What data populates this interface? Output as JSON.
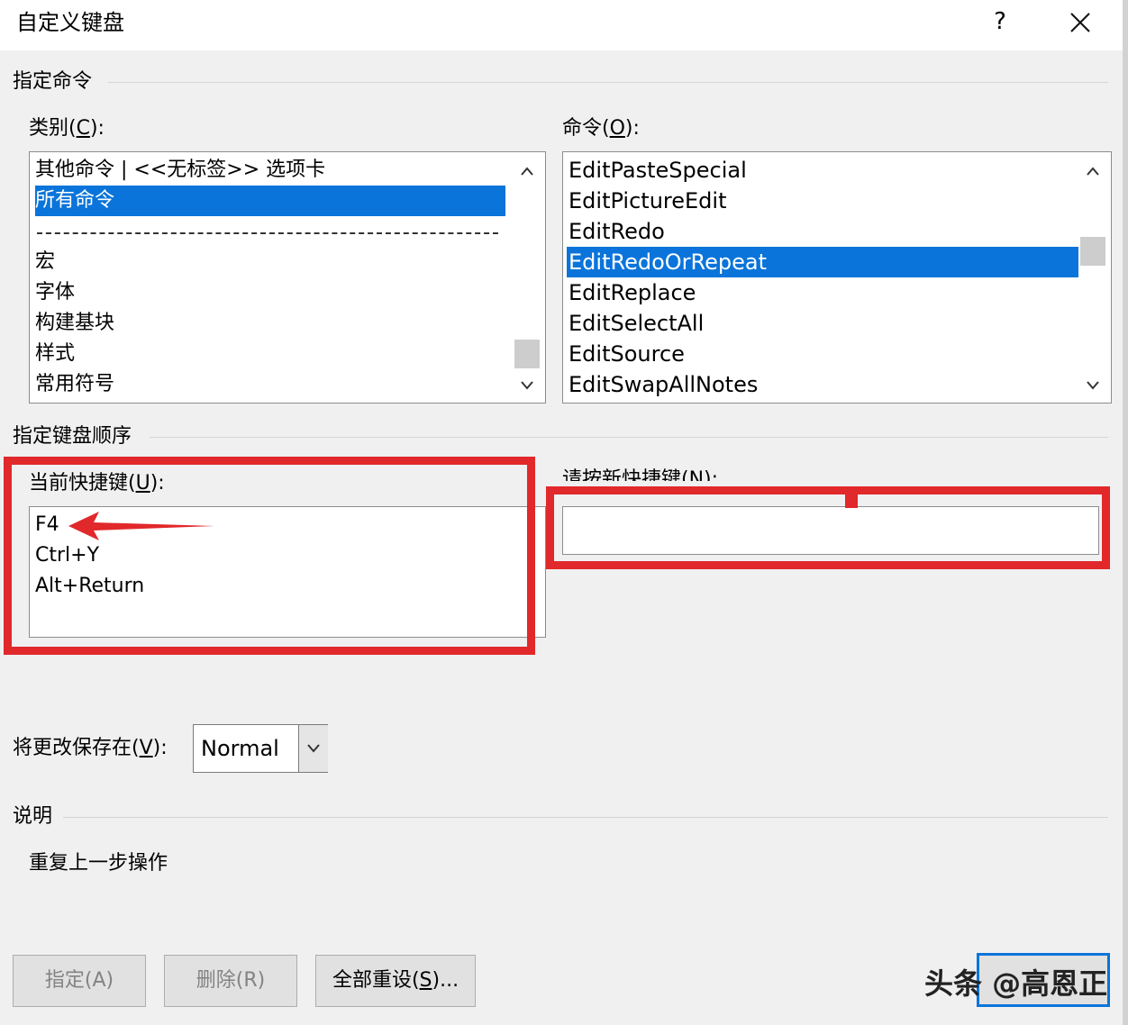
{
  "dialog": {
    "title": "自定义键盘",
    "help_label": "?",
    "close_label": "close"
  },
  "assign_command": {
    "section_title": "指定命令",
    "categories": {
      "label_prefix": "类别(",
      "label_key": "C",
      "label_suffix": "):",
      "items": [
        "其他命令 | <<无标签>> 选项卡",
        "所有命令",
        "宏",
        "字体",
        "构建基块",
        "样式",
        "常用符号"
      ],
      "selected": "所有命令"
    },
    "commands": {
      "label_prefix": "命令(",
      "label_key": "O",
      "label_suffix": "):",
      "items": [
        "EditPasteSpecial",
        "EditPictureEdit",
        "EditRedo",
        "EditRedoOrRepeat",
        "EditReplace",
        "EditSelectAll",
        "EditSource",
        "EditSwapAllNotes"
      ],
      "selected": "EditRedoOrRepeat"
    }
  },
  "keyboard_sequence": {
    "section_title": "指定键盘顺序",
    "current_keys": {
      "label_prefix": "当前快捷键(",
      "label_key": "U",
      "label_suffix": "):",
      "items": [
        "F4",
        "Ctrl+Y",
        "Alt+Return"
      ]
    },
    "new_key": {
      "label": "请按新快捷键(N):",
      "value": ""
    }
  },
  "save_in": {
    "label_prefix": "将更改保存在(",
    "label_key": "V",
    "label_suffix": "):",
    "value": "Normal"
  },
  "description": {
    "section_title": "说明",
    "text": "重复上一步操作"
  },
  "buttons": {
    "assign": "指定(A)",
    "remove": "删除(R)",
    "reset_all_prefix": "全部重设(",
    "reset_all_key": "S",
    "reset_all_suffix": ")..."
  },
  "watermark": "头条 @高恩正",
  "colors": {
    "selection": "#0a74da",
    "annotation_red": "#e1282b",
    "dialog_bg": "#f0f0f0"
  }
}
